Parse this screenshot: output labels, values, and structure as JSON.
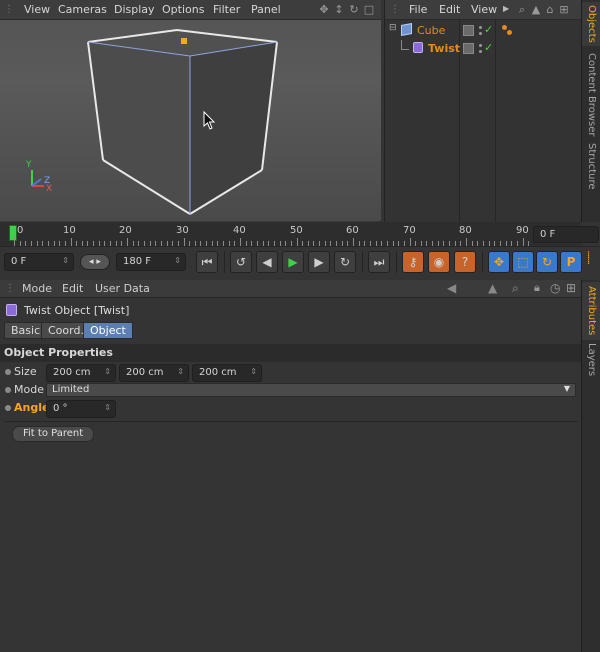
{
  "viewport": {
    "menu": [
      "View",
      "Cameras",
      "Display",
      "Options",
      "Filter",
      "Panel"
    ],
    "axes": {
      "x": "X",
      "y": "Y",
      "z": "Z"
    }
  },
  "object_manager": {
    "menu": [
      "File",
      "Edit",
      "View"
    ],
    "objects": [
      {
        "name": "Cube",
        "icon": "cube-icon"
      },
      {
        "name": "Twist",
        "icon": "twist-deformer-icon"
      }
    ]
  },
  "side_tabs_top": [
    "Objects",
    "Content Browser",
    "Structure"
  ],
  "side_tabs_bottom": [
    "Attributes",
    "Layers"
  ],
  "timeline": {
    "ticks": [
      "0",
      "10",
      "20",
      "30",
      "40",
      "50",
      "60",
      "70",
      "80",
      "90"
    ],
    "current_frame_field": "0 F"
  },
  "transport": {
    "start_field": "0 F",
    "end_field": "180 F"
  },
  "attributes": {
    "menu": [
      "Mode",
      "Edit",
      "User Data"
    ],
    "object_title": "Twist Object [Twist]",
    "tabs": [
      "Basic",
      "Coord.",
      "Object"
    ],
    "selected_tab": "Object",
    "section": "Object Properties",
    "size_label": "Size",
    "size_values": [
      "200 cm",
      "200 cm",
      "200 cm"
    ],
    "mode_label": "Mode",
    "mode_value": "Limited",
    "angle_label": "Angle",
    "angle_value": "0 °",
    "fit_button": "Fit to Parent"
  },
  "colors": {
    "accent": "#f5a623",
    "play": "#3fd14a",
    "selected_tab": "#5b7fb3"
  }
}
